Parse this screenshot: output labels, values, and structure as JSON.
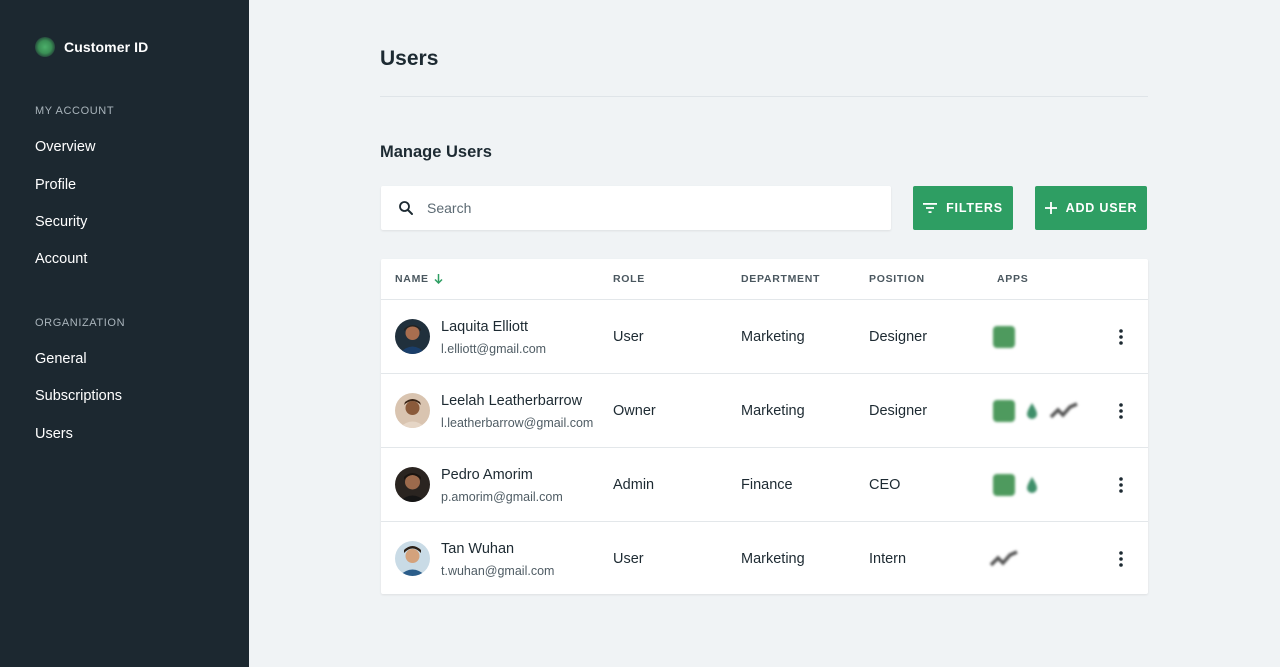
{
  "sidebar": {
    "brand": "Customer ID",
    "sections": [
      {
        "heading": "MY ACCOUNT",
        "items": [
          "Overview",
          "Profile",
          "Security",
          "Account"
        ]
      },
      {
        "heading": "ORGANIZATION",
        "items": [
          "General",
          "Subscriptions",
          "Users"
        ]
      }
    ]
  },
  "main": {
    "title": "Users",
    "section_title": "Manage Users",
    "search": {
      "placeholder": "Search",
      "value": ""
    },
    "filters_label": "FILTERS",
    "add_user_label": "ADD USER",
    "table": {
      "columns": [
        "NAME",
        "ROLE",
        "DEPARTMENT",
        "POSITION",
        "APPS"
      ],
      "sort_column": "NAME",
      "sort_direction": "descending",
      "rows": [
        {
          "name": "Laquita Elliott",
          "email": "l.elliott@gmail.com",
          "role": "User",
          "department": "Marketing",
          "position": "Designer",
          "apps": [
            "green-square-app-icon"
          ]
        },
        {
          "name": "Leelah Leatherbarrow",
          "email": "l.leatherbarrow@gmail.com",
          "role": "Owner",
          "department": "Marketing",
          "position": "Designer",
          "apps": [
            "green-square-app-icon",
            "drop-app-icon",
            "scribble-app-icon"
          ]
        },
        {
          "name": "Pedro Amorim",
          "email": "p.amorim@gmail.com",
          "role": "Admin",
          "department": "Finance",
          "position": "CEO",
          "apps": [
            "green-square-app-icon",
            "drop-app-icon"
          ]
        },
        {
          "name": "Tan Wuhan",
          "email": "t.wuhan@gmail.com",
          "role": "User",
          "department": "Marketing",
          "position": "Intern",
          "apps": [
            "scribble-app-icon"
          ]
        }
      ]
    }
  },
  "colors": {
    "sidebar_bg": "#1c2830",
    "page_bg": "#f0f3f5",
    "accent": "#2e9e63",
    "text_primary": "#1d2a32"
  }
}
